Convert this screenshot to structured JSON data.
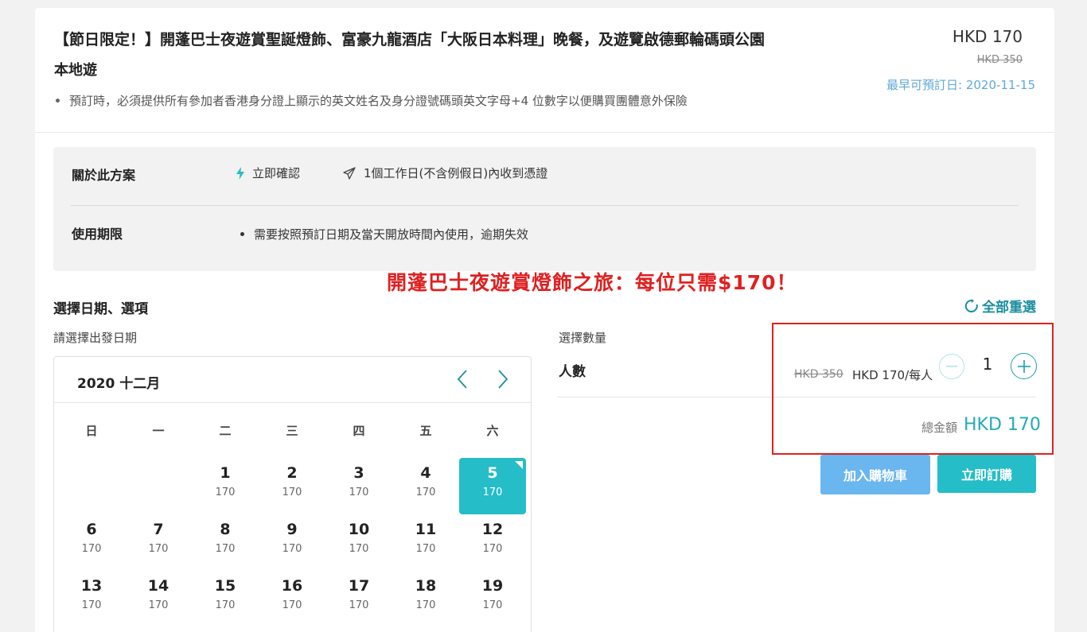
{
  "product": {
    "title": "【節日限定！】開蓬巴士夜遊賞聖誕燈飾、富豪九龍酒店「大阪日本料理」晚餐，及遊覽啟德郵輪碼頭公園",
    "subtitle": "本地遊",
    "note": "預訂時，必須提供所有參加者香港身分證上顯示的英文姓名及身分證號碼頭英文字母+4 位數字以便購買團體意外保險",
    "price": "HKD 170",
    "original_price": "HKD 350",
    "earliest_booking": "最早可預訂日: 2020-11-15"
  },
  "info": {
    "about_label": "關於此方案",
    "instant_confirm": "立即確認",
    "voucher_delivery": "1個工作日(不含例假日)內收到憑證",
    "validity_label": "使用期限",
    "validity_text": "需要按照預訂日期及當天開放時間內使用，逾期失效"
  },
  "promo_text": "開蓬巴士夜遊賞燈飾之旅：每位只需$170！",
  "selection": {
    "title": "選擇日期、選項",
    "reset_label": "全部重選",
    "date_label": "請選擇出發日期",
    "qty_label": "選擇數量"
  },
  "calendar": {
    "month": "2020 十二月",
    "weekdays": [
      "日",
      "一",
      "二",
      "三",
      "四",
      "五",
      "六"
    ],
    "selected_day": "5",
    "days": [
      {
        "d": "1",
        "p": "170"
      },
      {
        "d": "2",
        "p": "170"
      },
      {
        "d": "3",
        "p": "170"
      },
      {
        "d": "4",
        "p": "170"
      },
      {
        "d": "5",
        "p": "170"
      },
      {
        "d": "6",
        "p": "170"
      },
      {
        "d": "7",
        "p": "170"
      },
      {
        "d": "8",
        "p": "170"
      },
      {
        "d": "9",
        "p": "170"
      },
      {
        "d": "10",
        "p": "170"
      },
      {
        "d": "11",
        "p": "170"
      },
      {
        "d": "12",
        "p": "170"
      },
      {
        "d": "13",
        "p": "170"
      },
      {
        "d": "14",
        "p": "170"
      },
      {
        "d": "15",
        "p": "170"
      },
      {
        "d": "16",
        "p": "170"
      },
      {
        "d": "17",
        "p": "170"
      },
      {
        "d": "18",
        "p": "170"
      },
      {
        "d": "19",
        "p": "170"
      }
    ]
  },
  "quantity": {
    "persons_label": "人數",
    "unit_original": "HKD 350",
    "unit_price": "HKD 170/每人",
    "value": "1",
    "total_label": "總金額",
    "total_value": "HKD 170"
  },
  "buttons": {
    "add_to_cart": "加入購物車",
    "book_now": "立即訂購"
  },
  "colors": {
    "accent": "#25bdc7",
    "highlight_red": "#e02020",
    "cart_button": "#6ab6ee"
  }
}
